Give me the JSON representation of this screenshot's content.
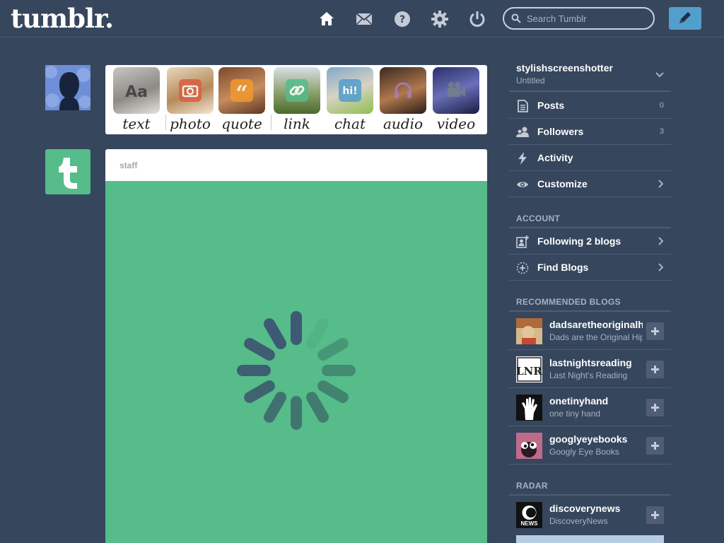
{
  "header": {
    "logo": "tumblr.",
    "search_placeholder": "Search Tumblr",
    "nav_icons": [
      "home-icon",
      "mail-icon",
      "help-icon",
      "settings-icon",
      "power-icon"
    ],
    "compose_icon": "pencil-icon"
  },
  "post_types": [
    {
      "label": "text",
      "icon": "text-icon",
      "color": "#444444"
    },
    {
      "label": "photo",
      "icon": "camera-icon",
      "color": "#d95e40"
    },
    {
      "label": "quote",
      "icon": "quote-icon",
      "color": "#f2992e"
    },
    {
      "label": "link",
      "icon": "link-icon",
      "color": "#56bc8a"
    },
    {
      "label": "chat",
      "icon": "chat-icon",
      "color": "#529ecc"
    },
    {
      "label": "audio",
      "icon": "headphones-icon",
      "color": "#a77dc2"
    },
    {
      "label": "video",
      "icon": "video-camera-icon",
      "color": "#748089"
    }
  ],
  "post": {
    "author": "staff",
    "body_color": "#56bc8a",
    "loading": true
  },
  "sidebar": {
    "blog_name": "stylishscreenshotter",
    "blog_title": "Untitled",
    "items": [
      {
        "label": "Posts",
        "count": "0",
        "icon": "posts-icon"
      },
      {
        "label": "Followers",
        "count": "3",
        "icon": "followers-icon"
      },
      {
        "label": "Activity",
        "icon": "activity-icon"
      },
      {
        "label": "Customize",
        "icon": "eye-icon"
      }
    ],
    "account_heading": "ACCOUNT",
    "account_items": [
      {
        "label": "Following 2 blogs",
        "icon": "following-icon"
      },
      {
        "label": "Find Blogs",
        "icon": "find-blogs-icon"
      }
    ],
    "recommended_heading": "RECOMMENDED BLOGS",
    "recommended": [
      {
        "name": "dadsaretheoriginalhipster",
        "title": "Dads are the Original Hipster"
      },
      {
        "name": "lastnightsreading",
        "title": "Last Night's Reading"
      },
      {
        "name": "onetinyhand",
        "title": "one tiny hand"
      },
      {
        "name": "googlyeyebooks",
        "title": "Googly Eye Books"
      }
    ],
    "radar_heading": "RADAR",
    "radar": {
      "name": "discoverynews",
      "title": "DiscoveryNews",
      "avatar_text": "NEWS"
    }
  },
  "colors": {
    "background": "#36465d",
    "accent_blue": "#529ecc",
    "staff_green": "#56bc8a",
    "muted_text": "#a6b1c0"
  }
}
